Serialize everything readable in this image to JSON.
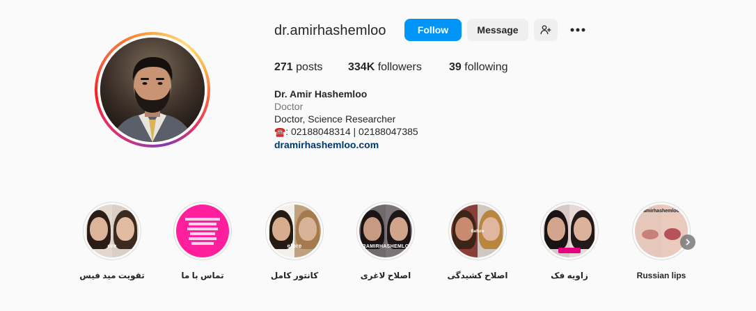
{
  "profile": {
    "username": "dr.amirhashemloo",
    "follow_label": "Follow",
    "message_label": "Message",
    "add_user_icon": "add-user-icon",
    "more_icon": "more-options-icon"
  },
  "stats": {
    "posts_count": "271",
    "posts_label": "posts",
    "followers_count": "334K",
    "followers_label": "followers",
    "following_count": "39",
    "following_label": "following"
  },
  "bio": {
    "name": "Dr. Amir Hashemloo",
    "category": "Doctor",
    "description": "Doctor, Science Researcher",
    "phone_icon": "☎️",
    "phones": ": 02188048314 | 02188047385",
    "link": "dramirhashemloo.com"
  },
  "highlights": [
    {
      "label": "تقویت مید فیس",
      "tag": "ore"
    },
    {
      "label": "تماس با ما",
      "tag": ""
    },
    {
      "label": "کانتور کامل",
      "tag": "efore"
    },
    {
      "label": "اصلاح لاغری",
      "tag": "RAMIRHASHEMLO"
    },
    {
      "label": "اصلاح کشیدگی",
      "tag": "Before"
    },
    {
      "label": "زاویه فک",
      "tag": ""
    },
    {
      "label": "Russian lips",
      "tag": "amirhashemloo"
    }
  ],
  "colors": {
    "follow_button": "#0095f6",
    "secondary_button": "#efefef",
    "link": "#00376b",
    "highlight_pink": "#ff1e9b"
  }
}
